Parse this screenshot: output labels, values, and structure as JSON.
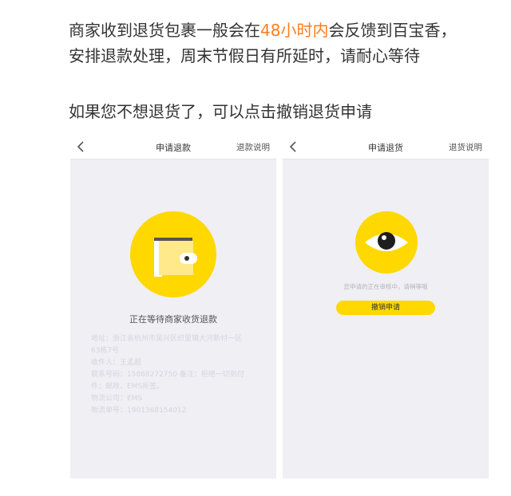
{
  "intro": {
    "line1_before": "商家收到退货包裹一般会在",
    "line1_highlight": "48小时内",
    "line1_after": "会反馈到百宝香，",
    "line2": "安排退款处理，周末节假日有所延时，请耐心等待"
  },
  "cancel_note": "如果您不想退货了，可以点击撤销退货申请",
  "left_screen": {
    "nav": {
      "title": "申请退款",
      "link": "退款说明"
    },
    "status": "正在等待商家收货退款",
    "details": [
      "地址：浙江省杭州市吴兴区织里镇大河新村一区",
      "63栋7号",
      "收件人：王孟超",
      "联系号码：15868272750 备注：拒绝一切到付",
      "件；邮政、EMS拒签。",
      "物流公司：EMS",
      "物流单号：1901368154012"
    ]
  },
  "right_screen": {
    "nav": {
      "title": "申请退货",
      "link": "退货说明"
    },
    "hint": "您申请的正在审核中，请稍等哦",
    "button": "撤销申请"
  },
  "colors": {
    "accent_yellow": "#ffd800",
    "highlight_orange": "#ff7d1e",
    "screen_bg": "#efeff4"
  },
  "icons": [
    "back-chevron-icon",
    "wallet-icon",
    "eye-icon"
  ]
}
